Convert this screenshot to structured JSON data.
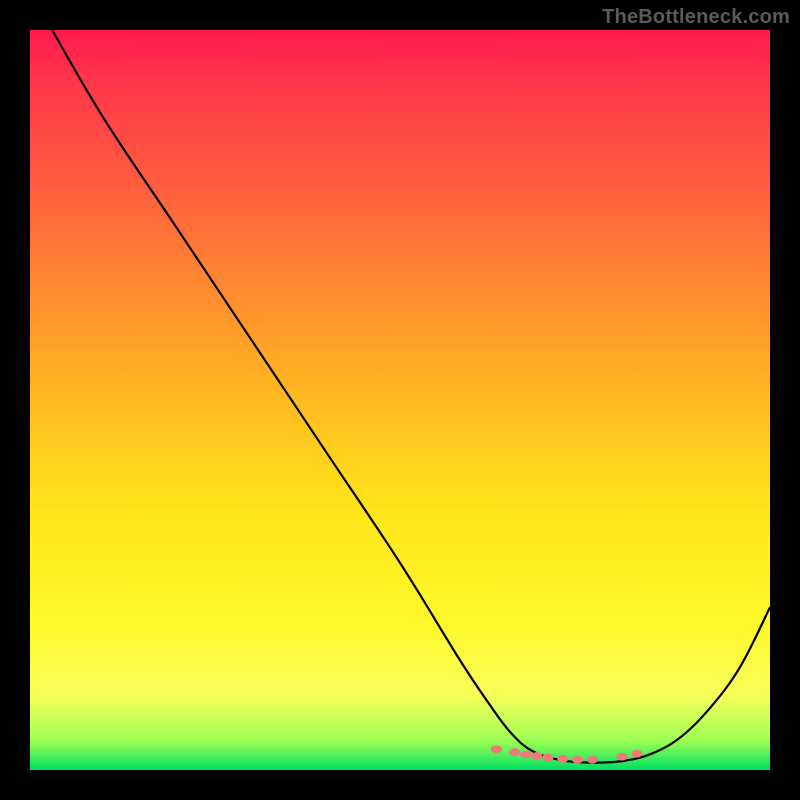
{
  "watermark": "TheBottleneck.com",
  "chart_data": {
    "type": "line",
    "title": "",
    "xlabel": "",
    "ylabel": "",
    "xlim": [
      0,
      100
    ],
    "ylim": [
      0,
      100
    ],
    "grid": false,
    "series": [
      {
        "name": "curve",
        "x": [
          3,
          10,
          20,
          30,
          40,
          50,
          58,
          62,
          65,
          68,
          72,
          76,
          80,
          84,
          88,
          92,
          96,
          100
        ],
        "y": [
          100,
          88,
          73,
          58,
          43,
          28,
          15,
          9,
          5,
          2.5,
          1.3,
          1.0,
          1.2,
          2.2,
          4.5,
          8.5,
          14,
          22
        ],
        "color": "#000000"
      }
    ],
    "markers": {
      "name": "highlight-dots",
      "x": [
        63,
        65.5,
        67,
        68.5,
        70,
        72,
        74,
        76,
        80,
        82
      ],
      "y": [
        2.8,
        2.4,
        2.1,
        1.9,
        1.7,
        1.5,
        1.4,
        1.4,
        1.8,
        2.2
      ],
      "color": "#f07878",
      "size": 7
    },
    "legend": false
  }
}
